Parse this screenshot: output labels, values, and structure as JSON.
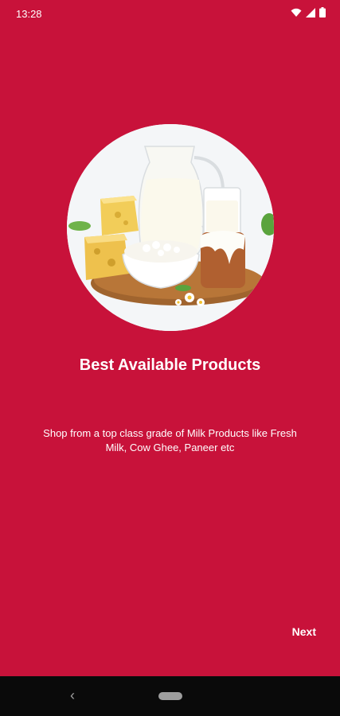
{
  "status_bar": {
    "time": "13:28",
    "icons": [
      "wifi-icon",
      "signal-icon",
      "battery-icon"
    ]
  },
  "onboarding": {
    "image_icon": "dairy-products-illustration",
    "title": "Best Available Products",
    "description": "Shop from a top class grade of Milk Products like Fresh Milk, Cow Ghee, Paneer etc",
    "next_label": "Next"
  },
  "navigation_bar": {
    "back_icon": "back-chevron-icon",
    "home_icon": "home-pill-icon"
  },
  "colors": {
    "background": "#c8123a",
    "text": "#ffffff",
    "nav_bar": "#0a0a0a"
  }
}
